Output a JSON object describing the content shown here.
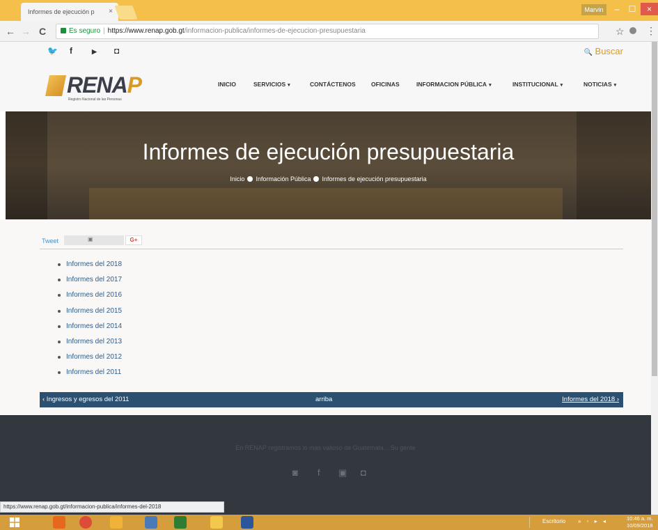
{
  "browser": {
    "tab_title": "Informes de ejecución p",
    "tab_close": "×",
    "user": "Marvin",
    "win_min": "–",
    "win_max": "☐",
    "win_close": "×",
    "back": "←",
    "forward": "→",
    "reload": "C",
    "secure_label": "Es seguro",
    "url_host": "https://www.renap.gob.gt",
    "url_path": "/informacion-publica/informes-de-ejecucion-presupuestaria",
    "star": "☆",
    "menu": "⋮"
  },
  "topbar": {
    "social": [
      {
        "icon": "twitter-icon",
        "glyph": "🐦"
      },
      {
        "icon": "facebook-icon",
        "glyph": "f"
      },
      {
        "icon": "youtube-icon",
        "glyph": "▶"
      },
      {
        "icon": "instagram-icon",
        "glyph": "◘"
      }
    ],
    "search_label": "Buscar",
    "search_glyph": "🔍"
  },
  "header": {
    "logo_main": "RENA",
    "logo_accent": "P",
    "logo_sub": "Registro Nacional de las Personas",
    "nav": [
      {
        "label": "INICIO",
        "dropdown": false
      },
      {
        "label": "SERVICIOS",
        "dropdown": true
      },
      {
        "label": "CONTÁCTENOS",
        "dropdown": false
      },
      {
        "label": "OFICINAS",
        "dropdown": false
      },
      {
        "label": "INFORMACION PÚBLICA",
        "dropdown": true
      },
      {
        "label": "INSTITUCIONAL",
        "dropdown": true
      },
      {
        "label": "NOTICIAS",
        "dropdown": true
      }
    ],
    "caret": "▾"
  },
  "hero": {
    "title": "Informes de ejecución presupuestaria",
    "breadcrumbs": [
      "Inicio",
      "Información Pública",
      "Informes de ejecución presupuestaria"
    ]
  },
  "share": {
    "tweet": "Tweet",
    "gplus": "G+"
  },
  "reports": [
    "Informes del 2018",
    "Informes del 2017",
    "Informes del 2016",
    "Informes del 2015",
    "Informes del 2014",
    "Informes del 2013",
    "Informes del 2012",
    "Informes del 2011"
  ],
  "pager": {
    "prev": "‹ Ingresos y egresos del 2011",
    "up": "arriba",
    "next": "Informes del 2018 ›"
  },
  "footer": {
    "motto": "En RENAP registramos lo más valioso de Guatemala... Su gente",
    "social": [
      "twitter-icon",
      "facebook-icon",
      "youtube-icon",
      "instagram-icon"
    ],
    "glyphs": [
      "◙",
      "f",
      "▣",
      "◘"
    ]
  },
  "status_url": "https://www.renap.gob.gt/informacion-publica/informes-del-2018",
  "taskbar": {
    "label": "Escritorio",
    "tray": "» ▫ ▸ ◂",
    "time": "10:46 a. m.",
    "date": "10/09/2018",
    "apps": [
      {
        "name": "firefox-icon",
        "color": "#e8671f"
      },
      {
        "name": "chrome-icon",
        "color": "#dd4b39"
      },
      {
        "name": "photos-icon",
        "color": "#f0b33a"
      },
      {
        "name": "paint-icon",
        "color": "#4a7ab8"
      },
      {
        "name": "project-icon",
        "color": "#2e7d32"
      },
      {
        "name": "explorer-icon",
        "color": "#f2c94c"
      },
      {
        "name": "word-icon",
        "color": "#2b579a"
      }
    ]
  }
}
